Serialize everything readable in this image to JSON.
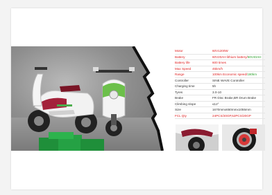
{
  "colors": {
    "accent_red": "#e02020",
    "accent_green": "#2aa02a",
    "scooter_green": "#6cc04a"
  },
  "specs": [
    {
      "label": "Motor",
      "value": "60V1200W",
      "tone": "red"
    },
    {
      "label": "Battery",
      "value": "60V20AH lithium battery/",
      "value_extra": "60V40AH",
      "tone": "red"
    },
    {
      "label": "Battery life",
      "value": "600 times",
      "tone": "red"
    },
    {
      "label": "Max Speed",
      "value": "45km/h",
      "tone": "red"
    },
    {
      "label": "Range",
      "value": "100km Economic speed/",
      "value_extra": "180km",
      "tone": "red"
    },
    {
      "label": "Controller",
      "value": "SINE WAVE Controller",
      "tone": "dark"
    },
    {
      "label": "Charging time",
      "value": "5h",
      "tone": "dark"
    },
    {
      "label": "Tyres",
      "value": "3.0-10",
      "tone": "dark"
    },
    {
      "label": "Brake",
      "value": "FR Disc Brake,BR Drum Brake",
      "tone": "dark"
    },
    {
      "label": "Climbing slope",
      "value": "≤12°",
      "tone": "dark"
    },
    {
      "label": "Size",
      "value": "1670mmx650mmx1055mm",
      "tone": "dark"
    },
    {
      "label": "FCL Qty",
      "value": "24PCS/20GP,52PCS/20GP",
      "tone": "red"
    }
  ]
}
